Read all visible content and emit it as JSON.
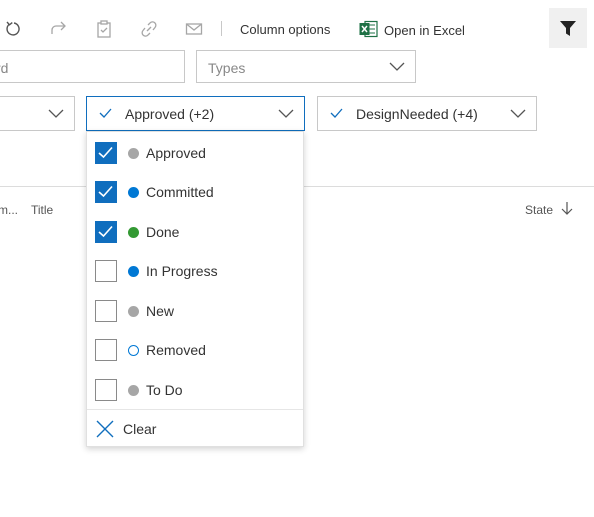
{
  "toolbar": {
    "column_options_label": "Column options",
    "open_in_excel_label": "Open in Excel"
  },
  "filters": {
    "keyword_partial": "rd",
    "types_placeholder": "Types",
    "state_selected": "Approved (+2)",
    "tags_selected": "DesignNeeded (+4)"
  },
  "columns": {
    "truncated_header": "m...",
    "title": "Title",
    "state": "State"
  },
  "state_dropdown": {
    "options": [
      {
        "label": "Approved",
        "checked": true,
        "dot": "#a6a6a6",
        "dot_style": "filled"
      },
      {
        "label": "Committed",
        "checked": true,
        "dot": "#0078d4",
        "dot_style": "filled"
      },
      {
        "label": "Done",
        "checked": true,
        "dot": "#339933",
        "dot_style": "filled"
      },
      {
        "label": "In Progress",
        "checked": false,
        "dot": "#0078d4",
        "dot_style": "filled"
      },
      {
        "label": "New",
        "checked": false,
        "dot": "#a6a6a6",
        "dot_style": "filled"
      },
      {
        "label": "Removed",
        "checked": false,
        "dot": "#0078d4",
        "dot_style": "outline"
      },
      {
        "label": "To Do",
        "checked": false,
        "dot": "#a6a6a6",
        "dot_style": "filled"
      }
    ],
    "clear_label": "Clear"
  },
  "colors": {
    "accent": "#106ebe",
    "excel_green": "#1e7145",
    "icon_gray": "#a6a6a6"
  }
}
